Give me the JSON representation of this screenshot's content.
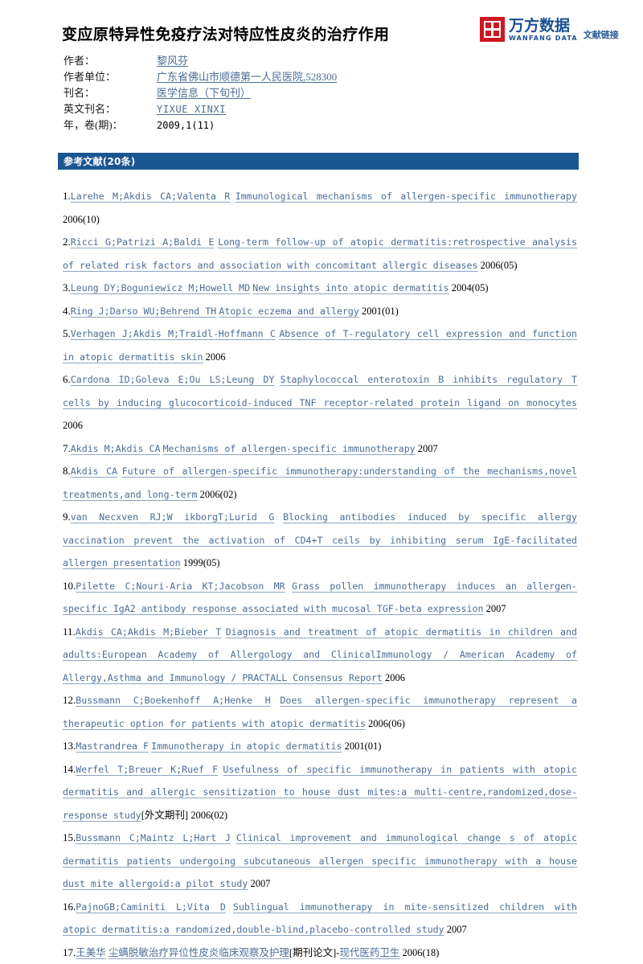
{
  "logo": {
    "mark": "wanfang-square-logo",
    "cn_name": "万方数据",
    "en_name": "WANFANG DATA",
    "link_label": "文献链接"
  },
  "document": {
    "title": "变应原特异性免疫疗法对特应性皮炎的治疗作用"
  },
  "meta": {
    "rows": [
      {
        "label": "作者：",
        "value": "黎风芬",
        "style": "cn-link"
      },
      {
        "label": "作者单位：",
        "value": "广东省佛山市顺德第一人民医院,528300",
        "style": "cn-link"
      },
      {
        "label": "刊名：",
        "value": "医学信息（下旬刊）",
        "style": "cn-link"
      },
      {
        "label": "英文刊名：",
        "value": "YIXUE XINXI",
        "style": "mono-link"
      },
      {
        "label": "年，卷(期)：",
        "value": "2009,1(11)",
        "style": "plain"
      }
    ]
  },
  "section": {
    "title": "参考文献(20条)"
  },
  "references": [
    {
      "num": "1.",
      "segments": [
        {
          "text": "Larehe M;Akdis CA;Valenta R",
          "type": "link"
        },
        {
          "text": " ",
          "type": "space"
        },
        {
          "text": "Immunological mechanisms of allergen-specific immunotherapy",
          "type": "link"
        },
        {
          "text": " 2006(10)",
          "type": "plain"
        }
      ]
    },
    {
      "num": "2.",
      "segments": [
        {
          "text": "Ricci G;Patrizi A;Baldi E",
          "type": "link"
        },
        {
          "text": " ",
          "type": "space"
        },
        {
          "text": "Long-term follow-up of atopic dermatitis:retrospective analysis of related risk factors and association with concomitant allergic diseases",
          "type": "link"
        },
        {
          "text": " 2006(05)",
          "type": "plain"
        }
      ]
    },
    {
      "num": "3.",
      "segments": [
        {
          "text": "Leung DY;Boguniewicz M;Howell MD",
          "type": "link"
        },
        {
          "text": " ",
          "type": "space"
        },
        {
          "text": "New insights into atopic dermatitis",
          "type": "link"
        },
        {
          "text": " 2004(05)",
          "type": "plain"
        }
      ]
    },
    {
      "num": "4.",
      "segments": [
        {
          "text": "Ring J;Darso WU;Behrend TH",
          "type": "link"
        },
        {
          "text": " ",
          "type": "space"
        },
        {
          "text": "Atopic eczema and allergy",
          "type": "link"
        },
        {
          "text": " 2001(01)",
          "type": "plain"
        }
      ]
    },
    {
      "num": "5.",
      "segments": [
        {
          "text": "Verhagen J;Akdis M;Traidl-Hoffmann C",
          "type": "link"
        },
        {
          "text": " ",
          "type": "space"
        },
        {
          "text": "Absence of T-regulatory cell expression and function in atopic dermatitis skin",
          "type": "link"
        },
        {
          "text": " 2006",
          "type": "plain"
        }
      ]
    },
    {
      "num": "6.",
      "segments": [
        {
          "text": "Cardona ID;Goleva E;Ou LS;Leung DY",
          "type": "link"
        },
        {
          "text": " ",
          "type": "space"
        },
        {
          "text": "Staphylococcal enterotoxin B inhibits regulatory T cells by inducing glucocorticoid-induced TNF receptor-related protein ligand on monocytes",
          "type": "link"
        },
        {
          "text": " 2006",
          "type": "plain"
        }
      ]
    },
    {
      "num": "7.",
      "segments": [
        {
          "text": "Akdis M;Akdis CA",
          "type": "link"
        },
        {
          "text": " ",
          "type": "space"
        },
        {
          "text": "Mechanisms of allergen-specific immunotherapy",
          "type": "link"
        },
        {
          "text": " 2007",
          "type": "plain"
        }
      ]
    },
    {
      "num": "8.",
      "segments": [
        {
          "text": "Akdis CA",
          "type": "link"
        },
        {
          "text": " ",
          "type": "space"
        },
        {
          "text": "Future of allergen-specific immunotherapy:understanding of the mechanisms,novel treatments,and long-term",
          "type": "link"
        },
        {
          "text": " 2006(02)",
          "type": "plain"
        }
      ]
    },
    {
      "num": "9.",
      "segments": [
        {
          "text": "van Necxven RJ;W ikborgT;Lurid G",
          "type": "link"
        },
        {
          "text": " ",
          "type": "space"
        },
        {
          "text": "Blocking antibodies induced by specific allergy vaccination prevent the activation of CD4+T ceils by inhibiting serum IgE-facilitated allergen presentation",
          "type": "link"
        },
        {
          "text": " 1999(05)",
          "type": "plain"
        }
      ]
    },
    {
      "num": "10.",
      "segments": [
        {
          "text": "Pilette C;Nouri-Aria KT;Jacobson MR",
          "type": "link"
        },
        {
          "text": " ",
          "type": "space"
        },
        {
          "text": "Grass pollen immunotherapy induces an allergen-specific IgA2 antibody response associated with mucosal TGF-beta expression",
          "type": "link"
        },
        {
          "text": " 2007",
          "type": "plain"
        }
      ]
    },
    {
      "num": "11.",
      "segments": [
        {
          "text": "Akdis CA;Akdis M;Bieber T",
          "type": "link"
        },
        {
          "text": " ",
          "type": "space"
        },
        {
          "text": "Diagnosis and treatment of atopic dermatitis in children and adults:European Academy of Allergology and ClinicalImmunology / American Academy of Allergy,Asthma and Immunology / PRACTALL Consensus Report",
          "type": "link"
        },
        {
          "text": " 2006",
          "type": "plain"
        }
      ]
    },
    {
      "num": "12.",
      "segments": [
        {
          "text": "Bussmann C;Boekenhoff A;Henke H",
          "type": "link"
        },
        {
          "text": " ",
          "type": "space"
        },
        {
          "text": "Does allergen-specific immunotherapy represent a therapeutic option for patients with atopic dermatitis",
          "type": "link"
        },
        {
          "text": " 2006(06)",
          "type": "plain"
        }
      ]
    },
    {
      "num": "13.",
      "segments": [
        {
          "text": "Mastrandrea F",
          "type": "link"
        },
        {
          "text": " ",
          "type": "space"
        },
        {
          "text": "Immunotherapy in atopic dermatitis",
          "type": "link"
        },
        {
          "text": " 2001(01)",
          "type": "plain"
        }
      ]
    },
    {
      "num": "14.",
      "segments": [
        {
          "text": "Werfel T;Breuer K;Ruef F",
          "type": "link"
        },
        {
          "text": " ",
          "type": "space"
        },
        {
          "text": "Usefulness of specific immunotherapy in patients with atopic dermatitis and allergic sensitization to house dust mites:a multi-centre,randomized,dose-response study",
          "type": "link"
        },
        {
          "text": "[外文期刊]",
          "type": "cn"
        },
        {
          "text": " 2006(02)",
          "type": "plain"
        }
      ]
    },
    {
      "num": "15.",
      "segments": [
        {
          "text": "Bussmann C;Maintz L;Hart J",
          "type": "link"
        },
        {
          "text": " ",
          "type": "space"
        },
        {
          "text": "Clinical improvement and immunological change s of atopic dermatitis patients undergoing subcutaneous allergen specific immunotherapy with a house dust mite allergoid:a pilot study",
          "type": "link"
        },
        {
          "text": " 2007",
          "type": "plain"
        }
      ]
    },
    {
      "num": "16.",
      "segments": [
        {
          "text": "PajnoGB;Caminiti L;Vita D",
          "type": "link"
        },
        {
          "text": " ",
          "type": "space"
        },
        {
          "text": "Sublingual immunotherapy in mite-sensitized children with atopic dermatitis:a randomized,double-blind,placebo-controlled study",
          "type": "link"
        },
        {
          "text": " 2007",
          "type": "plain"
        }
      ]
    },
    {
      "num": "17.",
      "segments": [
        {
          "text": "王美华",
          "type": "cn-link"
        },
        {
          "text": " ",
          "type": "space"
        },
        {
          "text": "尘螨脱敏治疗异位性皮炎临床观察及护理",
          "type": "cn-link"
        },
        {
          "text": "[期刊论文]-",
          "type": "cn"
        },
        {
          "text": "现代医药卫生",
          "type": "cn-link"
        },
        {
          "text": " 2006(18)",
          "type": "plain"
        }
      ]
    }
  ],
  "colors": {
    "link": "#4a6e96",
    "section_bar": "#1a5691",
    "logo_red": "#cf1722",
    "logo_blue": "#1a4f91",
    "text": "#000000",
    "background": "#ffffff"
  }
}
